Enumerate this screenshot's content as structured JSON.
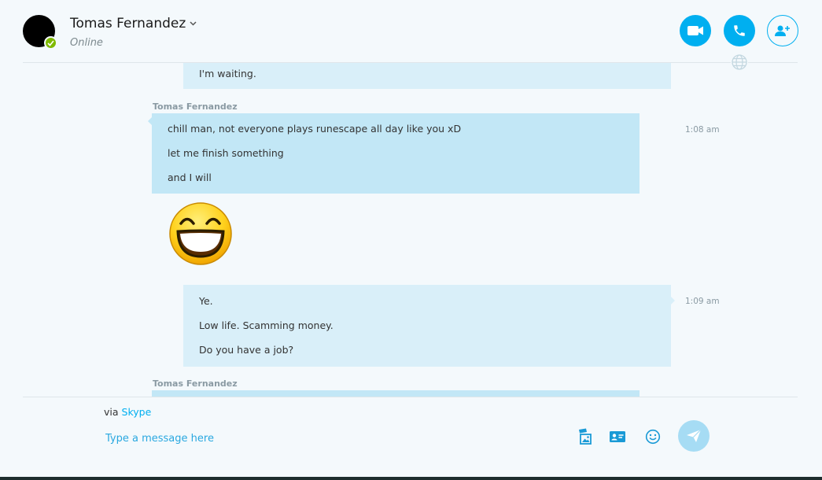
{
  "contact": {
    "name": "Tomas Fernandez",
    "status": "Online"
  },
  "header": {
    "icons": {
      "video": "video-camera-icon",
      "call": "phone-icon",
      "add": "add-person-icon",
      "globe": "globe-icon"
    }
  },
  "messages": [
    {
      "direction": "out",
      "lines": [
        "I'm waiting."
      ]
    },
    {
      "direction": "in",
      "sender": "Tomas Fernandez",
      "time": "1:08 am",
      "lines": [
        "chill man, not everyone plays runescape all day like you xD",
        "let me finish something",
        "and I will"
      ]
    },
    {
      "direction": "in",
      "emoticon": "big-grin-emoticon"
    },
    {
      "direction": "out",
      "time": "1:09 am",
      "lines": [
        "Ye.",
        "Low life. Scamming money.",
        "Do you have a job?"
      ]
    },
    {
      "direction": "in",
      "sender": "Tomas Fernandez"
    }
  ],
  "composer": {
    "via_prefix": "via",
    "via_service": "Skype",
    "placeholder": "Type a message here",
    "icons": [
      "media-gallery-icon",
      "contact-card-icon",
      "emoticon-icon",
      "send-icon"
    ]
  },
  "colors": {
    "accent": "#00aff0",
    "bubble_in": "#c2e7f6",
    "bubble_out": "#d9eff9",
    "presence": "#7fba00"
  }
}
